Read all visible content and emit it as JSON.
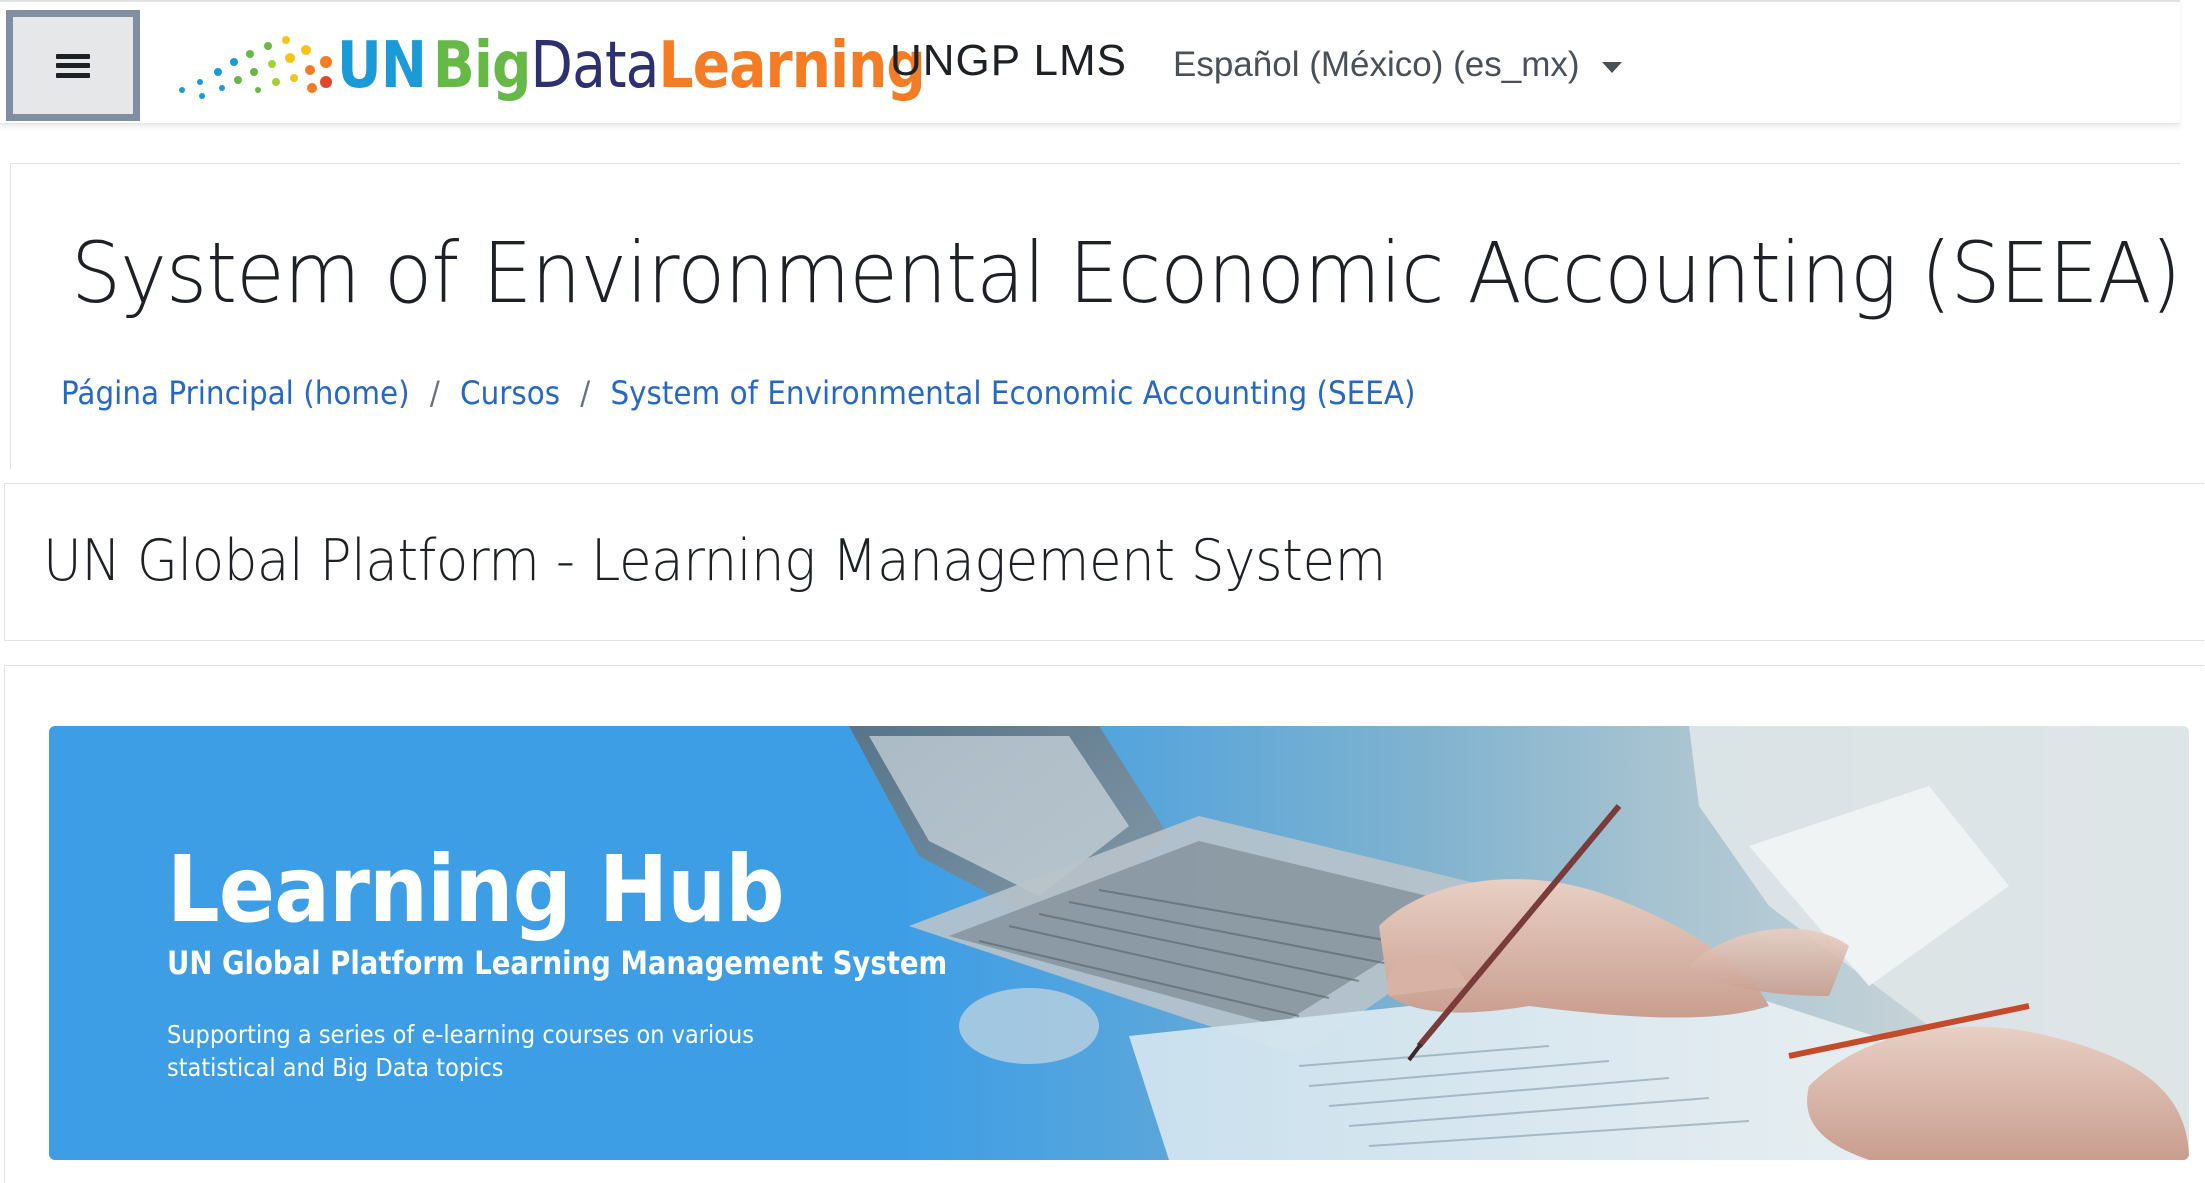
{
  "navbar": {
    "menu_button_label": "≡",
    "brand": {
      "un": "UN",
      "big": "Big",
      "data": "Data",
      "learning": "Learning"
    },
    "site_name": "UNGP LMS",
    "language": "Español (México) (es_mx)"
  },
  "page_header": {
    "title": "System of Environmental Economic Accounting (SEEA)",
    "breadcrumb": [
      "Página Principal (home)",
      "Cursos",
      "System of Environmental Economic Accounting (SEEA)"
    ],
    "breadcrumb_separator": "/"
  },
  "platform": {
    "title": "UN Global Platform - Learning Management System"
  },
  "banner": {
    "title": "Learning Hub",
    "subtitle": "UN Global Platform Learning Management System",
    "description": "Supporting a series of e-learning courses on various statistical and Big Data topics"
  },
  "colors": {
    "link": "#2668c5",
    "banner_blue": "#3d9ee6",
    "logo_un": "#1a9ad6",
    "logo_big": "#66b947",
    "logo_data": "#2c2f70",
    "logo_learning": "#f47c24"
  }
}
